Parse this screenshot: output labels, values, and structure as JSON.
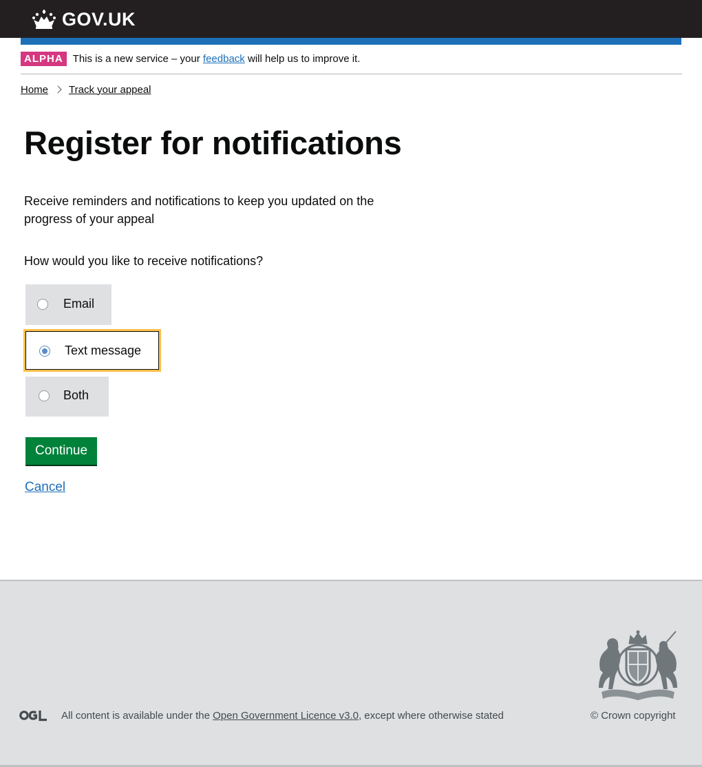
{
  "header": {
    "logo_text": "GOV.UK",
    "crown_icon": "crown-icon",
    "bar_color": "#1d70b8"
  },
  "phase_banner": {
    "tag": "ALPHA",
    "text_before": "This is a new service – your ",
    "link": "feedback",
    "text_after": " will help us to improve it.",
    "tag_color": "#d53880"
  },
  "breadcrumbs": {
    "items": [
      "Home",
      "Track your appeal"
    ]
  },
  "main": {
    "title": "Register for notifications",
    "intro": "Receive reminders and notifications to keep you updated  on the progress of your appeal",
    "question": "How would you like to receive notifications?",
    "options": [
      {
        "label": "Email",
        "selected": false
      },
      {
        "label": "Text message",
        "selected": true
      },
      {
        "label": "Both",
        "selected": false
      }
    ],
    "continue_label": "Continue",
    "cancel_label": "Cancel",
    "button_color": "#00823b",
    "focus_color": "#ffbf47"
  },
  "footer": {
    "licence_before": "All content is available under the ",
    "licence_link": "Open Government Licence v3.0",
    "licence_after": ", except where otherwise stated",
    "copyright": "© Crown copyright",
    "ogl_icon": "ogl-logo-icon",
    "crest_icon": "royal-coat-of-arms-icon"
  }
}
